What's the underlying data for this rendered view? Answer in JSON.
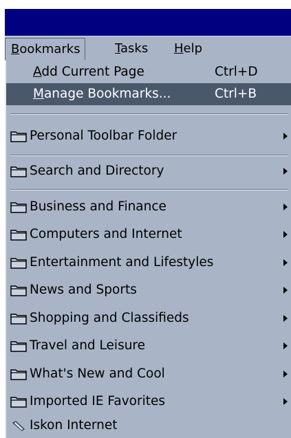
{
  "menubar": {
    "bookmarks": {
      "pre": "",
      "accel": "B",
      "post": "ookmarks"
    },
    "tasks": {
      "pre": "",
      "accel": "T",
      "post": "asks"
    },
    "help": {
      "pre": "",
      "accel": "H",
      "post": "elp"
    }
  },
  "menu": {
    "add_page": {
      "accel": "A",
      "post": "dd Current Page",
      "shortcut": "Ctrl+D"
    },
    "manage": {
      "accel": "M",
      "post": "anage Bookmarks...",
      "shortcut": "Ctrl+B"
    },
    "folders": [
      "Personal Toolbar Folder",
      "Search and Directory",
      "Business and Finance",
      "Computers and Internet",
      "Entertainment and Lifestyles",
      "News and Sports",
      "Shopping and Classifieds",
      "Travel and Leisure",
      "What's New and Cool",
      "Imported IE Favorites"
    ],
    "link": "Iskon Internet"
  },
  "colors": {
    "titlebar": "#000080",
    "menu_bg": "#a9b5c6",
    "highlight": "#4a586c"
  },
  "icons": {
    "folder": "folder-icon",
    "link": "bookmark-link-icon",
    "submenu": "submenu-arrow-icon"
  }
}
